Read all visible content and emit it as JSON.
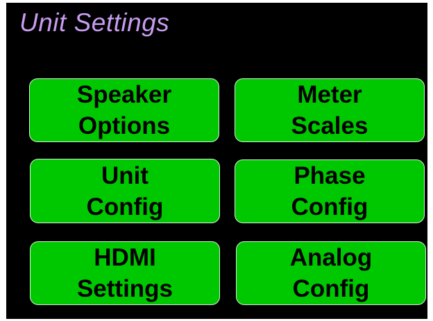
{
  "page": {
    "title": "Unit Settings"
  },
  "buttons": [
    {
      "line1": "Speaker",
      "line2": "Options"
    },
    {
      "line1": "Meter",
      "line2": "Scales"
    },
    {
      "line1": "Unit",
      "line2": "Config"
    },
    {
      "line1": "Phase",
      "line2": "Config"
    },
    {
      "line1": "HDMI",
      "line2": "Settings"
    },
    {
      "line1": "Analog",
      "line2": "Config"
    }
  ],
  "colors": {
    "background": "#000000",
    "title": "#c79cf0",
    "button_fill": "#00c800",
    "button_text": "#000000"
  }
}
